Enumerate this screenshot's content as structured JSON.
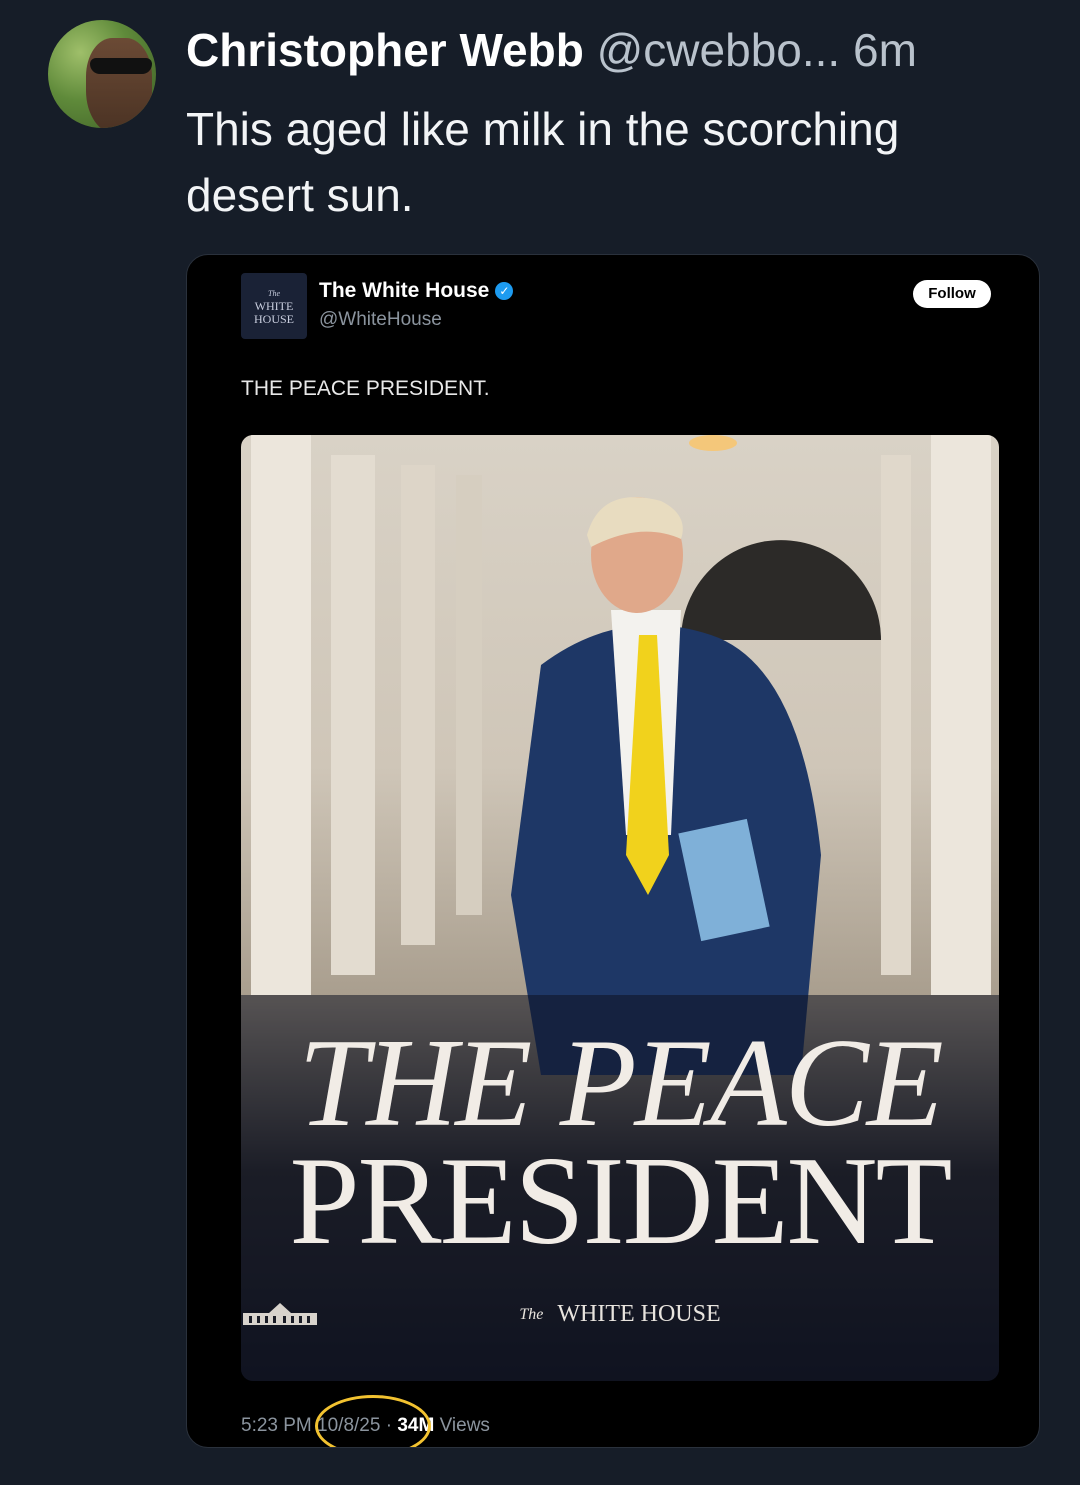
{
  "tweet": {
    "author_name": "Christopher Webb",
    "handle": "@cwebbo...",
    "time": "6m",
    "text": "This aged like milk in the scorching desert sun."
  },
  "embedded": {
    "account_name": "The White House",
    "handle": "@WhiteHouse",
    "logo_text_top": "The",
    "logo_text_1": "WHITE",
    "logo_text_2": "HOUSE",
    "follow_label": "Follow",
    "text": "THE PEACE PRESIDENT.",
    "poster": {
      "title_line1": "THE PEACE",
      "title_line2": "PRESIDENT",
      "brand_the": "The",
      "brand": "WHITE HOUSE"
    },
    "timestamp_time": "5:23 PM",
    "timestamp_date": "10/8/25",
    "views_count": "34M",
    "views_label": "Views"
  },
  "colors": {
    "background": "#161d28",
    "highlight_circle": "#f2c230",
    "verified_badge": "#1d9bf0"
  }
}
